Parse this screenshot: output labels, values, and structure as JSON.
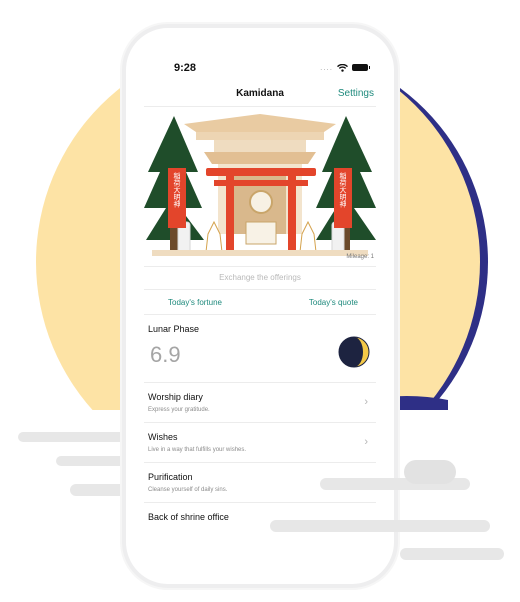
{
  "status_bar": {
    "time": "9:28",
    "signal_dots": "....",
    "wifi_icon": "wifi-icon",
    "battery_icon": "battery-icon"
  },
  "nav": {
    "title": "Kamidana",
    "settings": "Settings"
  },
  "shrine": {
    "banner_left": "稲荷大明神",
    "banner_right": "稲荷大明神",
    "mileage": "Mileage: 1"
  },
  "actions": {
    "exchange": "Exchange the offerings",
    "fortune": "Today's fortune",
    "quote": "Today's quote"
  },
  "lunar": {
    "title": "Lunar Phase",
    "value": "6.9",
    "icon": "moon-phase-icon"
  },
  "menu": [
    {
      "title": "Worship diary",
      "subtitle": "Express your gratitude."
    },
    {
      "title": "Wishes",
      "subtitle": "Live in a way that fulfills your wishes."
    },
    {
      "title": "Purification",
      "subtitle": "Cleanse yourself of daily sins."
    },
    {
      "title": "Back of shrine office",
      "subtitle": ""
    }
  ],
  "colors": {
    "accent": "#1f8a7d",
    "circle_yellow": "#fde3a5",
    "circle_navy": "#2e2f86",
    "torii_red": "#e3452b"
  }
}
